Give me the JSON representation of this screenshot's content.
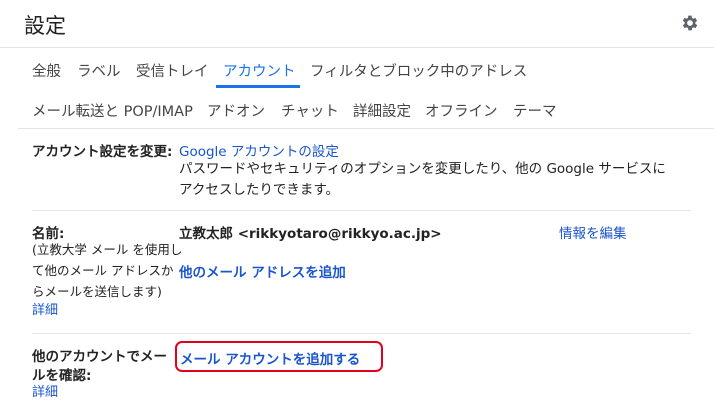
{
  "page": {
    "title": "設定",
    "icons": {
      "settings": "gear-icon"
    }
  },
  "tabs_row1": [
    {
      "label": "全般"
    },
    {
      "label": "ラベル"
    },
    {
      "label": "受信トレイ"
    },
    {
      "label": "アカウント",
      "active": true
    },
    {
      "label": "フィルタとブロック中のアドレス"
    }
  ],
  "tabs_row2": [
    {
      "label": "メール転送と POP/IMAP"
    },
    {
      "label": "アドオン"
    },
    {
      "label": "チャット"
    },
    {
      "label": "詳細設定"
    },
    {
      "label": "オフライン"
    },
    {
      "label": "テーマ"
    }
  ],
  "account_settings": {
    "label": "アカウント設定を変更:",
    "link": "Google アカウントの設定",
    "desc_line1": "パスワードやセキュリティのオプションを変更したり、他の Google サービスに",
    "desc_line2": "アクセスしたりできます。"
  },
  "name_section": {
    "label": "名前:",
    "help_line1": "(立教大学 メール を使用し",
    "help_line2": "て他のメール アドレスか",
    "help_line3": "らメールを送信します)",
    "details": "詳細",
    "identity": "立教太郎 <rikkyotaro@rikkyo.ac.jp>",
    "edit_link": "情報を編集",
    "add_address_link": "他のメール アドレスを追加"
  },
  "check_other": {
    "label_line1": "他のアカウントでメー",
    "label_line2": "ルを確認:",
    "details": "詳細",
    "add_account_link": "メール アカウントを追加する"
  },
  "colors": {
    "accent": "#1a73e8",
    "link": "#1a55cc",
    "highlight": "#e3001b"
  }
}
